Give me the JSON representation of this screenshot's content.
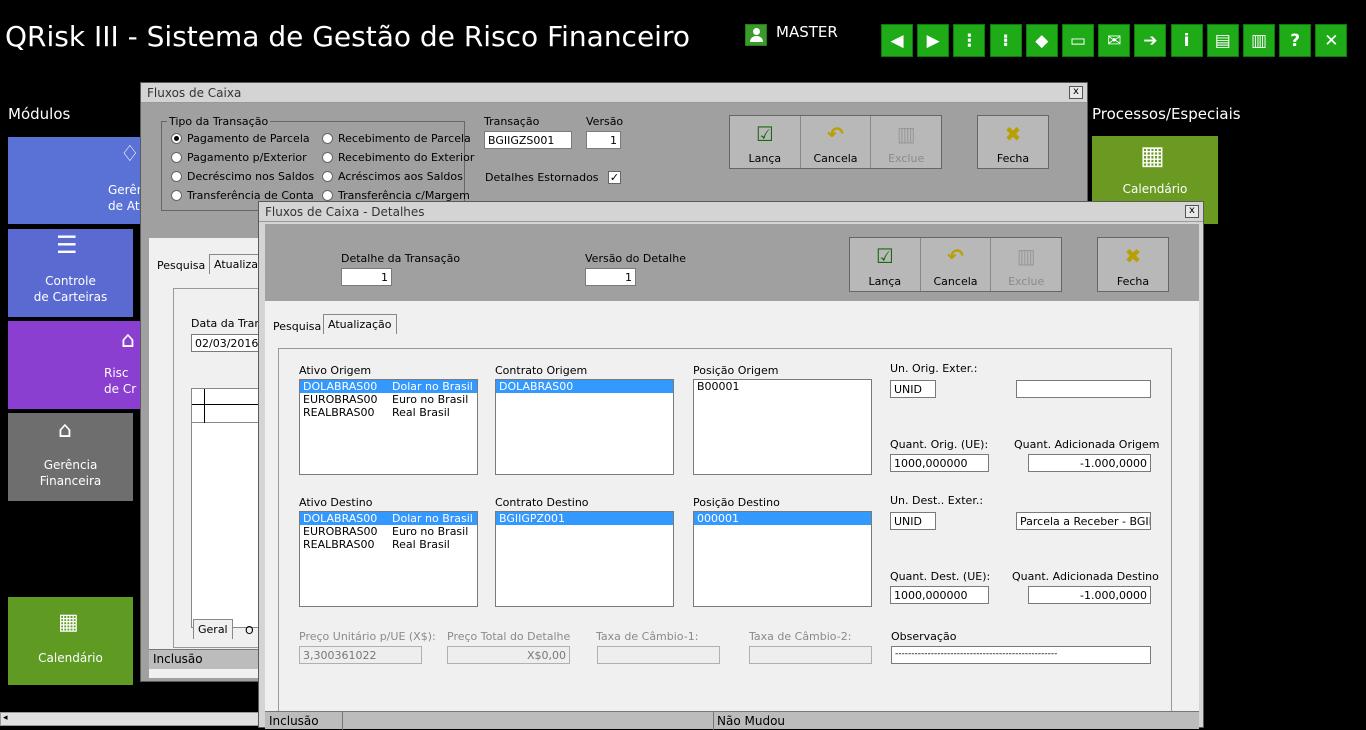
{
  "app": {
    "title": "QRisk III - Sistema de Gestão de Risco Financeiro",
    "user": "MASTER"
  },
  "toolbar": [
    {
      "icon": "arrow-left-icon",
      "glyph": "◀"
    },
    {
      "icon": "arrow-right-icon",
      "glyph": "▶"
    },
    {
      "icon": "traffic-light-icon",
      "glyph": "⋮"
    },
    {
      "icon": "vertical-light-icon",
      "glyph": "⁝"
    },
    {
      "icon": "paint-bucket-icon",
      "glyph": "◆"
    },
    {
      "icon": "monitor-icon",
      "glyph": "▭"
    },
    {
      "icon": "mail-icon",
      "glyph": "✉"
    },
    {
      "icon": "forward-mail-icon",
      "glyph": "➔"
    },
    {
      "icon": "info-icon",
      "glyph": "i"
    },
    {
      "icon": "document-settings-icon",
      "glyph": "▤"
    },
    {
      "icon": "calendar-settings-icon",
      "glyph": "▥"
    },
    {
      "icon": "help-icon",
      "glyph": "?"
    },
    {
      "icon": "close-icon",
      "glyph": "✕"
    }
  ],
  "modules": {
    "title": "Módulos",
    "tiles": [
      "Gerên\nde At",
      "Controle\nde Carteiras",
      "Risc\nde Cr",
      "Gerência\nFinanceira",
      "Calendário"
    ]
  },
  "processos": {
    "title": "Processos/Especiais",
    "calendar": "Calendário"
  },
  "fluxos": {
    "title": "Fluxos de Caixa",
    "close": "x",
    "tipo_group": "Tipo da Transação",
    "tipos_left": [
      "Pagamento de Parcela",
      "Pagamento p/Exterior",
      "Decréscimo nos Saldos",
      "Transferência de Conta"
    ],
    "tipos_right": [
      "Recebimento de Parcela",
      "Recebimento do Exterior",
      "Acréscimos aos Saldos",
      "Transferência c/Margem"
    ],
    "transacao_label": "Transação",
    "transacao": "BGIIGZS001",
    "versao_label": "Versão",
    "versao": "1",
    "detalhes_estornados": "Detalhes Estornados",
    "estornado_check": "✓",
    "buttons": {
      "lanca": "Lança",
      "cancela": "Cancela",
      "exclue": "Exclue",
      "fecha": "Fecha"
    },
    "tabs": [
      "Pesquisa",
      "Atualiza"
    ],
    "data_label": "Data da Tran",
    "data": "02/03/2016",
    "bottom_tabs": [
      "Geral",
      "O"
    ],
    "status": "Inclusão"
  },
  "detalhes": {
    "title": "Fluxos de Caixa - Detalhes",
    "close": "x",
    "detalhe_label": "Detalhe da Transação",
    "detalhe": "1",
    "versao_label": "Versão do Detalhe",
    "versao": "1",
    "buttons": {
      "lanca": "Lança",
      "cancela": "Cancela",
      "exclue": "Exclue",
      "fecha": "Fecha"
    },
    "tabs": [
      "Pesquisa",
      "Atualização"
    ],
    "ativo_origem_label": "Ativo Origem",
    "ativo_origem": [
      {
        "code": "DOLABRAS00",
        "name": "Dolar no Brasil"
      },
      {
        "code": "EUROBRAS00",
        "name": "Euro no Brasil"
      },
      {
        "code": "REALBRAS00",
        "name": "Real Brasil"
      }
    ],
    "contrato_origem_label": "Contrato Origem",
    "contrato_origem": [
      "DOLABRAS00"
    ],
    "posicao_origem_label": "Posição Origem",
    "posicao_origem": [
      "B00001"
    ],
    "un_orig_label": "Un. Orig. Exter.:",
    "un_orig": "UNID",
    "un_orig_ext": "",
    "quant_orig_label": "Quant. Orig. (UE):",
    "quant_orig": "1000,000000",
    "quant_adic_orig_label": "Quant. Adicionada Origem",
    "quant_adic_orig": "-1.000,0000",
    "ativo_destino_label": "Ativo Destino",
    "ativo_destino": [
      {
        "code": "DOLABRAS00",
        "name": "Dolar no Brasil"
      },
      {
        "code": "EUROBRAS00",
        "name": "Euro no Brasil"
      },
      {
        "code": "REALBRAS00",
        "name": "Real Brasil"
      }
    ],
    "contrato_destino_label": "Contrato Destino",
    "contrato_destino": [
      "BGIIGPZ001"
    ],
    "posicao_destino_label": "Posição Destino",
    "posicao_destino": [
      "000001"
    ],
    "un_dest_label": "Un. Dest.. Exter.:",
    "un_dest": "UNID",
    "un_dest_ext": "Parcela a Receber - BGIIGI",
    "quant_dest_label": "Quant. Dest. (UE):",
    "quant_dest": "1000,000000",
    "quant_adic_dest_label": "Quant. Adicionada Destino",
    "quant_adic_dest": "-1.000,0000",
    "preco_unit_label": "Preço Unitário p/UE (X$):",
    "preco_unit": "3,300361022",
    "preco_total_label": "Preço Total do Detalhe",
    "preco_total": "X$0,00",
    "taxa1_label": "Taxa de Câmbio-1:",
    "taxa1": "",
    "taxa2_label": "Taxa de Câmbio-2:",
    "taxa2": "",
    "obs_label": "Observação",
    "obs": "--------------------------------------------------",
    "status_left": "Inclusão",
    "status_right": "Não Mudou"
  },
  "colors": {
    "accent_green": "#1faa18",
    "selection": "#3399ff"
  }
}
